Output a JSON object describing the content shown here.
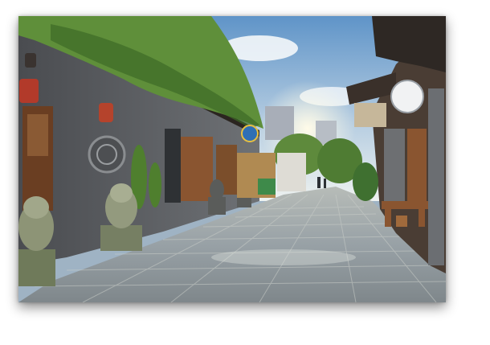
{
  "image": {
    "subject": "old-town-stone-alley-street",
    "shadow": "drop-shadow",
    "colors": {
      "sky_top": "#5f94c8",
      "sky_bottom": "#dfe9f2",
      "ivy": "#5f8f3a",
      "ivy_dark": "#3d6a26",
      "brick": "#6b6e72",
      "wood": "#7a4a2a",
      "pavement": "#9aa4ab",
      "pavement_light": "#c8ccc6",
      "lantern": "#b23a2a",
      "sign_blue": "#2f6fb5"
    }
  }
}
